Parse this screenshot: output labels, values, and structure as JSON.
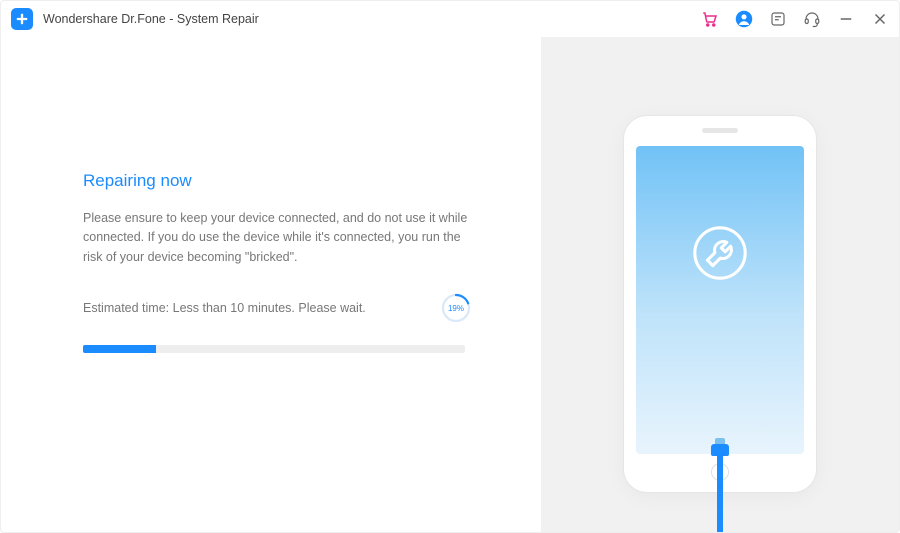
{
  "title": "Wondershare Dr.Fone - System Repair",
  "heading": "Repairing now",
  "description": "Please ensure to keep your device connected, and do not use it while connected. If you do use the device while it's connected, you run the risk of your device becoming \"bricked\".",
  "estimated_time_label": "Estimated time: Less than 10 minutes. Please wait.",
  "progress": {
    "percent": 19,
    "percent_label": "19%"
  }
}
